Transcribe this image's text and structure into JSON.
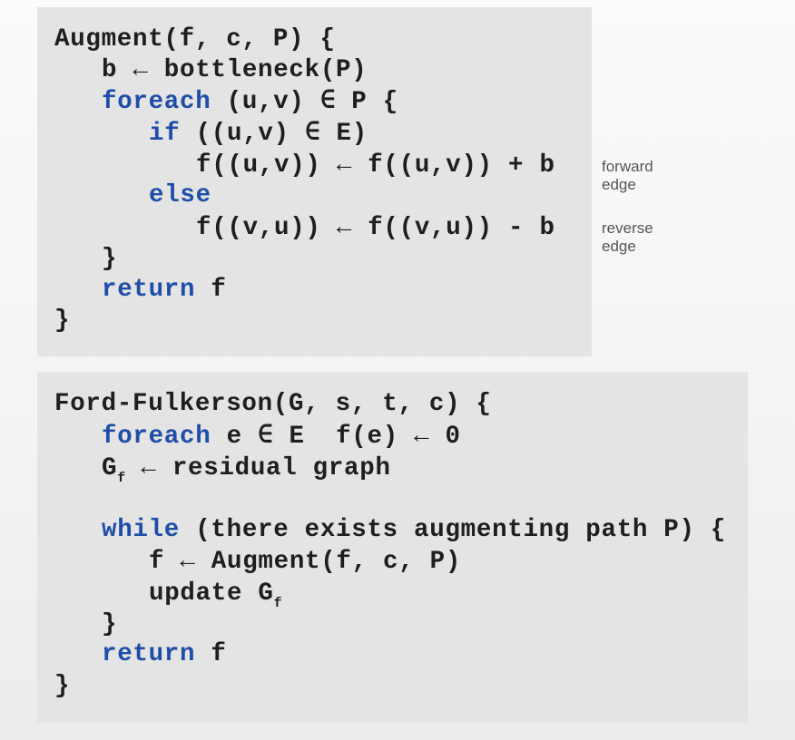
{
  "augment": {
    "lines": [
      {
        "indent": 0,
        "segs": [
          {
            "t": "Augment(f, c, P) {"
          }
        ]
      },
      {
        "indent": 1,
        "segs": [
          {
            "t": "b ← bottleneck(P)"
          }
        ]
      },
      {
        "indent": 1,
        "segs": [
          {
            "t": "foreach",
            "kw": true
          },
          {
            "t": " (u,v) ∈ P {"
          }
        ]
      },
      {
        "indent": 2,
        "segs": [
          {
            "t": "if",
            "kw": true
          },
          {
            "t": " ((u,v) ∈ E)"
          }
        ]
      },
      {
        "indent": 3,
        "segs": [
          {
            "t": "f((u,v)) ← f((u,v)) + b"
          }
        ]
      },
      {
        "indent": 2,
        "segs": [
          {
            "t": "else",
            "kw": true
          }
        ]
      },
      {
        "indent": 3,
        "segs": [
          {
            "t": "f((v,u)) ← f((v,u)) - b"
          }
        ]
      },
      {
        "indent": 1,
        "segs": [
          {
            "t": "}"
          }
        ]
      },
      {
        "indent": 1,
        "segs": [
          {
            "t": "return",
            "kw": true
          },
          {
            "t": " f"
          }
        ]
      },
      {
        "indent": 0,
        "segs": [
          {
            "t": "}"
          }
        ]
      }
    ],
    "comments": {
      "forward": "forward edge",
      "reverse": "reverse edge"
    }
  },
  "ford_fulkerson": {
    "lines": [
      {
        "indent": 0,
        "segs": [
          {
            "t": "Ford-Fulkerson(G, s, t, c) {"
          }
        ]
      },
      {
        "indent": 1,
        "segs": [
          {
            "t": "foreach",
            "kw": true
          },
          {
            "t": " e ∈ E  f(e) ← 0"
          }
        ]
      },
      {
        "indent": 1,
        "segs": [
          {
            "t": "G"
          },
          {
            "t": "f",
            "sub": true
          },
          {
            "t": " ← residual graph"
          }
        ]
      },
      {
        "indent": 0,
        "segs": []
      },
      {
        "indent": 1,
        "segs": [
          {
            "t": "while",
            "kw": true
          },
          {
            "t": " (there exists augmenting path P) {"
          }
        ]
      },
      {
        "indent": 2,
        "segs": [
          {
            "t": "f ← Augment(f, c, P)"
          }
        ]
      },
      {
        "indent": 2,
        "segs": [
          {
            "t": "update G"
          },
          {
            "t": "f",
            "sub": true
          }
        ]
      },
      {
        "indent": 1,
        "segs": [
          {
            "t": "}"
          }
        ]
      },
      {
        "indent": 1,
        "segs": [
          {
            "t": "return",
            "kw": true
          },
          {
            "t": " f"
          }
        ]
      },
      {
        "indent": 0,
        "segs": [
          {
            "t": "}"
          }
        ]
      }
    ]
  }
}
